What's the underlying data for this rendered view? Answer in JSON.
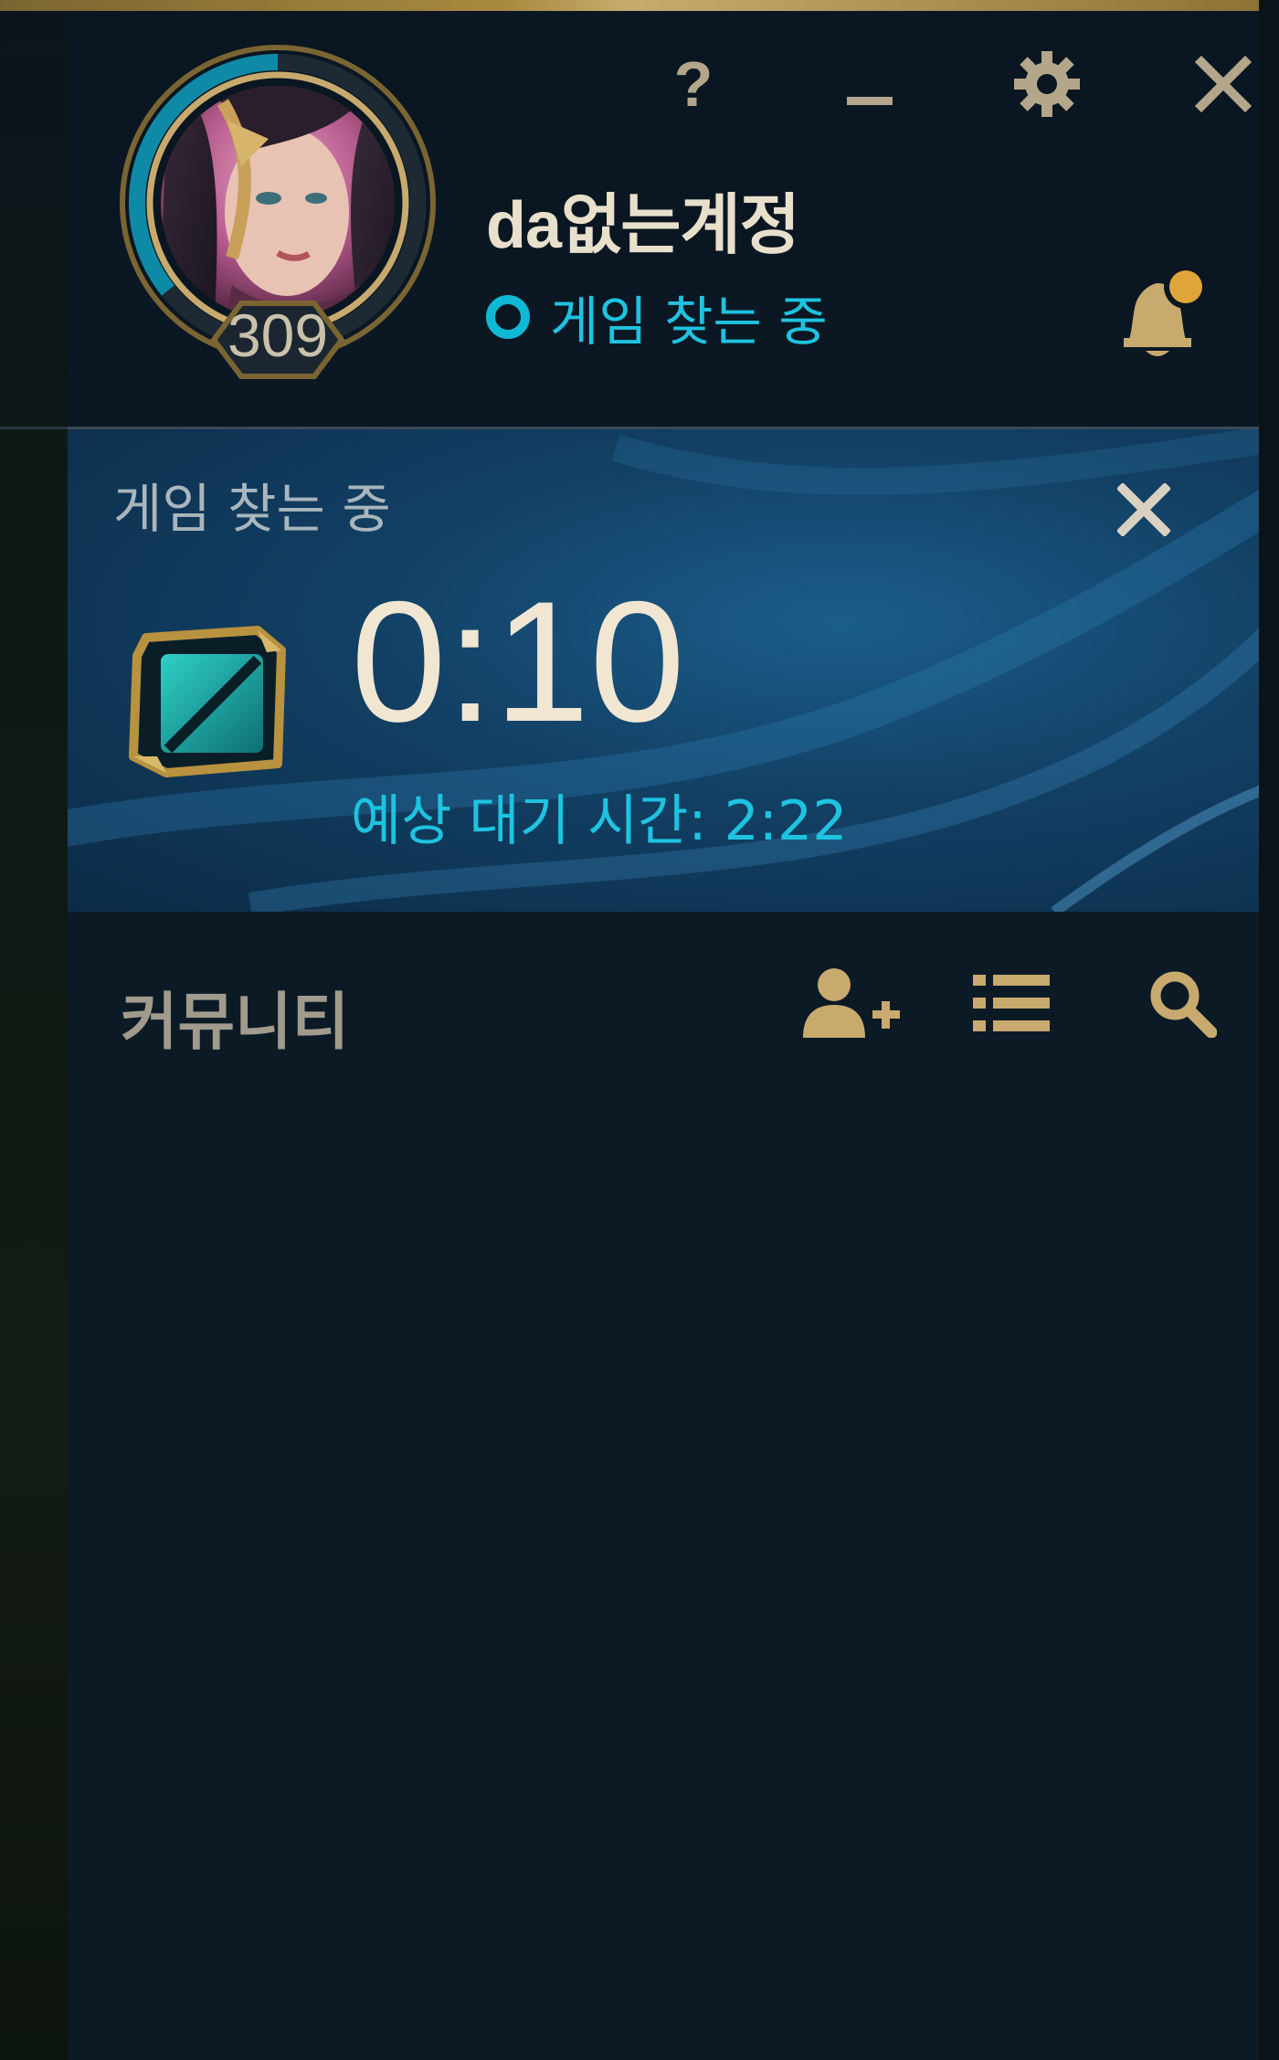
{
  "window_controls": {
    "help_label": "?",
    "minimize_icon": "minimize-icon",
    "settings_icon": "gear-icon",
    "close_icon": "close-icon"
  },
  "profile": {
    "level": "309",
    "username": "da없는계정",
    "status": "게임 찾는 중",
    "status_color": "#1ec3e0",
    "avatar_icon": "champion-portrait"
  },
  "notifications": {
    "icon": "bell-icon",
    "has_unread": true
  },
  "queue": {
    "title": "게임 찾는 중",
    "elapsed": "0:10",
    "estimated_label": "예상 대기 시간: 2:22",
    "icon": "queue-mode-icon"
  },
  "community": {
    "title": "커뮤니티",
    "add_friend_icon": "add-friend-icon",
    "list_icon": "list-icon",
    "search_icon": "search-icon"
  },
  "colors": {
    "gold": "#c8aa6e",
    "accent_cyan": "#1ec3e0",
    "panel_bg": "#0c1a26"
  }
}
